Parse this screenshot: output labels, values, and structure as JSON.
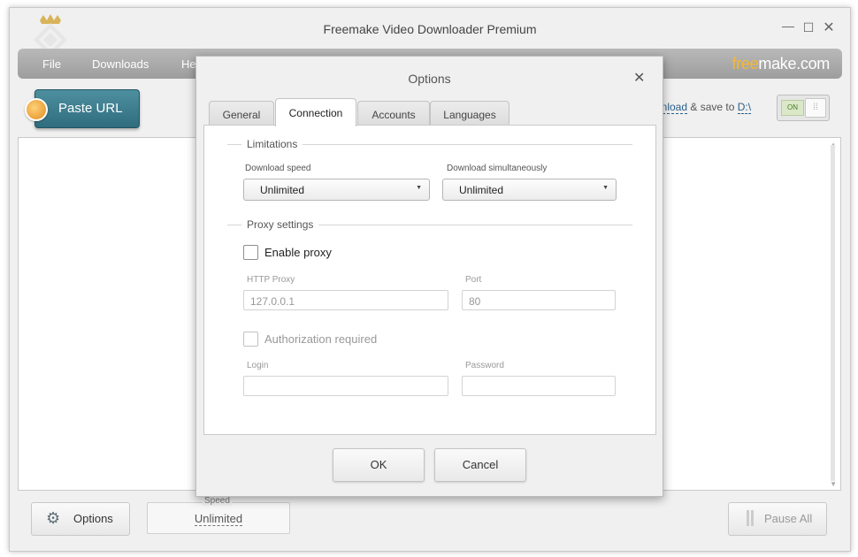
{
  "window": {
    "title": "Freemake Video Downloader Premium"
  },
  "menu": {
    "items": [
      "File",
      "Downloads",
      "He"
    ],
    "brand_free": "free",
    "brand_make": "make.com"
  },
  "toolbar": {
    "paste_url": "Paste URL",
    "save_text_link": "wnload",
    "save_text_mid": "& save to",
    "save_path": "D:\\",
    "toggle_state": "ON"
  },
  "bottom": {
    "options_label": "Options",
    "speed_caption": "Speed",
    "speed_value": "Unlimited",
    "pause_label": "Pause All"
  },
  "dialog": {
    "title": "Options",
    "tabs": [
      {
        "label": "General",
        "active": false
      },
      {
        "label": "Connection",
        "active": true
      },
      {
        "label": "Accounts",
        "active": false
      },
      {
        "label": "Languages",
        "active": false
      }
    ],
    "limitations": {
      "title": "Limitations",
      "download_speed_label": "Download speed",
      "download_speed_value": "Unlimited",
      "simultaneous_label": "Download simultaneously",
      "simultaneous_value": "Unlimited"
    },
    "proxy": {
      "title": "Proxy settings",
      "enable_label": "Enable proxy",
      "enable_checked": false,
      "http_label": "HTTP Proxy",
      "http_value": "127.0.0.1",
      "port_label": "Port",
      "port_value": "80",
      "auth_label": "Authorization required",
      "auth_checked": false,
      "login_label": "Login",
      "login_value": "",
      "password_label": "Password",
      "password_value": ""
    },
    "ok_label": "OK",
    "cancel_label": "Cancel"
  },
  "colors": {
    "brand_accent": "#f7b733",
    "paste_button": "#3b7b8c",
    "menubar": "#a9a9a9"
  }
}
